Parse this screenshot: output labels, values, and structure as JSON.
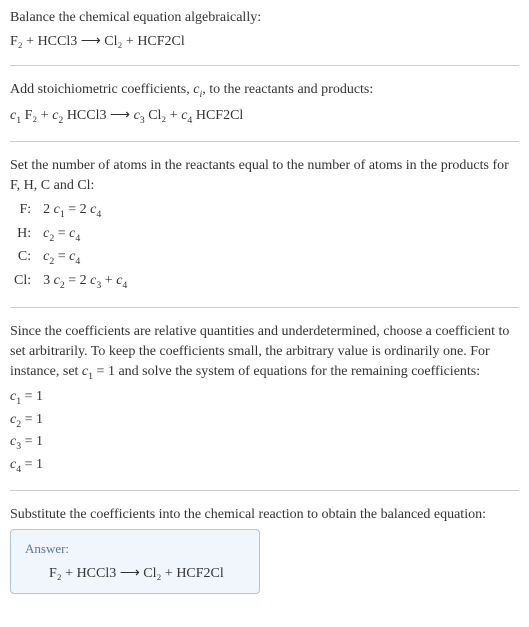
{
  "s1": {
    "title": "Balance the chemical equation algebraically:",
    "eq": "F₂ + HCCl3 ⟶ Cl₂ + HCF2Cl"
  },
  "s2": {
    "title_a": "Add stoichiometric coefficients, ",
    "title_ci": "c",
    "title_i": "i",
    "title_b": ", to the reactants and products:",
    "eq_c1": "c",
    "eq_1": "1",
    "eq_f2": " F₂ + ",
    "eq_c2": "c",
    "eq_2": "2",
    "eq_hccl3": " HCCl3 ⟶ ",
    "eq_c3": "c",
    "eq_3": "3",
    "eq_cl2": " Cl₂ + ",
    "eq_c4": "c",
    "eq_4": "4",
    "eq_hcf2cl": " HCF2Cl"
  },
  "s3": {
    "title": "Set the number of atoms in the reactants equal to the number of atoms in the products for F, H, C and Cl:",
    "rows": [
      {
        "el": "F:",
        "lhs_a": "2 ",
        "lhs_c": "c",
        "lhs_n": "1",
        "mid": " = 2 ",
        "rhs_c": "c",
        "rhs_n": "4",
        "tail": ""
      },
      {
        "el": "H:",
        "lhs_a": "",
        "lhs_c": "c",
        "lhs_n": "2",
        "mid": " = ",
        "rhs_c": "c",
        "rhs_n": "4",
        "tail": ""
      },
      {
        "el": "C:",
        "lhs_a": "",
        "lhs_c": "c",
        "lhs_n": "2",
        "mid": " = ",
        "rhs_c": "c",
        "rhs_n": "4",
        "tail": ""
      },
      {
        "el": "Cl:",
        "lhs_a": "3 ",
        "lhs_c": "c",
        "lhs_n": "2",
        "mid": " = 2 ",
        "rhs_c": "c",
        "rhs_n": "3",
        "tail_a": " + ",
        "tail_c": "c",
        "tail_n": "4"
      }
    ]
  },
  "s4": {
    "p1a": "Since the coefficients are relative quantities and underdetermined, choose a coefficient to set arbitrarily. To keep the coefficients small, the arbitrary value is ordinarily one. For instance, set ",
    "p1c": "c",
    "p1n": "1",
    "p1b": " = 1 and solve the system of equations for the remaining coefficients:",
    "coeffs": [
      {
        "c": "c",
        "n": "1",
        "v": " = 1"
      },
      {
        "c": "c",
        "n": "2",
        "v": " = 1"
      },
      {
        "c": "c",
        "n": "3",
        "v": " = 1"
      },
      {
        "c": "c",
        "n": "4",
        "v": " = 1"
      }
    ]
  },
  "s5": {
    "title": "Substitute the coefficients into the chemical reaction to obtain the balanced equation:",
    "answer_label": "Answer:",
    "answer_eq": "F₂ + HCCl3 ⟶ Cl₂ + HCF2Cl"
  }
}
